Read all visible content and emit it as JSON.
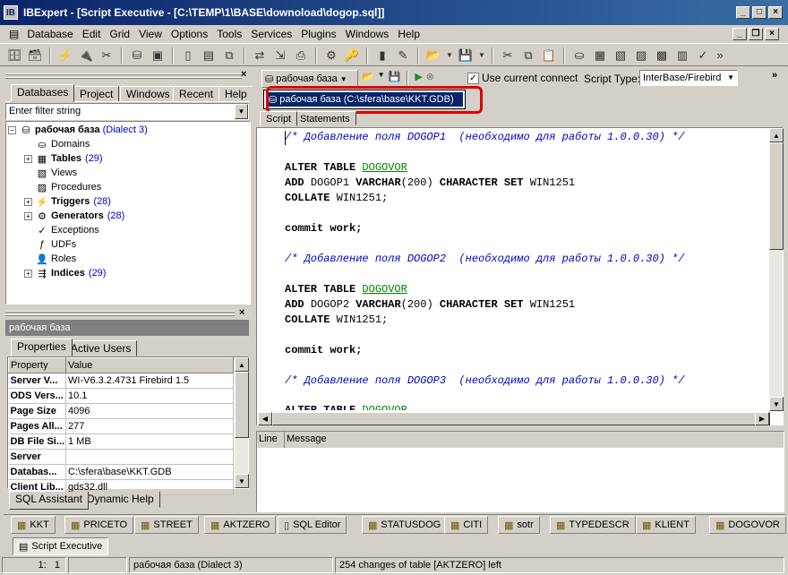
{
  "window": {
    "title": "IBExpert - [Script Executive - [C:\\TEMP\\1\\BASE\\downoload\\dogop.sql]]"
  },
  "menu": [
    "Database",
    "Edit",
    "Grid",
    "View",
    "Options",
    "Tools",
    "Services",
    "Plugins",
    "Windows",
    "Help"
  ],
  "db_explorer": {
    "tabs": [
      "Databases",
      "Project",
      "Windows",
      "Recent",
      "Help"
    ],
    "filter_placeholder": "Enter filter string",
    "db_name": "рабочая база",
    "db_dialect": "(Dialect 3)",
    "nodes": [
      {
        "label": "Domains",
        "count": "",
        "expandable": false,
        "bold": false
      },
      {
        "label": "Tables",
        "count": "(29)",
        "expandable": true,
        "bold": true
      },
      {
        "label": "Views",
        "count": "",
        "expandable": false,
        "bold": false
      },
      {
        "label": "Procedures",
        "count": "",
        "expandable": false,
        "bold": false
      },
      {
        "label": "Triggers",
        "count": "(28)",
        "expandable": true,
        "bold": true
      },
      {
        "label": "Generators",
        "count": "(28)",
        "expandable": true,
        "bold": true
      },
      {
        "label": "Exceptions",
        "count": "",
        "expandable": false,
        "bold": false
      },
      {
        "label": "UDFs",
        "count": "",
        "expandable": false,
        "bold": false
      },
      {
        "label": "Roles",
        "count": "",
        "expandable": false,
        "bold": false
      },
      {
        "label": "Indices",
        "count": "(29)",
        "expandable": true,
        "bold": true
      }
    ]
  },
  "props": {
    "title": "рабочая база",
    "tabs": [
      "Properties",
      "Active Users"
    ],
    "col_property": "Property",
    "col_value": "Value",
    "rows": [
      {
        "k": "Server V...",
        "v": "WI-V6.3.2.4731 Firebird 1.5"
      },
      {
        "k": "ODS Vers...",
        "v": "10.1"
      },
      {
        "k": "Page Size",
        "v": "4096"
      },
      {
        "k": "Pages All...",
        "v": "277"
      },
      {
        "k": "DB File Si...",
        "v": "1 MB"
      },
      {
        "k": "Server",
        "v": ""
      },
      {
        "k": "Databas...",
        "v": "C:\\sfera\\base\\KKT.GDB"
      },
      {
        "k": "Client Lib...",
        "v": "gds32.dll"
      }
    ],
    "bottom_tabs": [
      "SQL Assistant",
      "Dynamic Help"
    ]
  },
  "script": {
    "db_combo": "рабочая база",
    "dropdown_item": "рабочая база (C:\\sfera\\base\\KKT.GDB)",
    "use_current_connect": "Use current connect",
    "script_type_label": "Script Type:",
    "script_type_value": "InterBase/Firebird",
    "tabs": [
      "Script",
      "Statements"
    ],
    "comment1": "/* Добавление поля DOGOP1  (необходимо для работы 1.0.0.30) */",
    "comment2": "/* Добавление поля DOGOP2  (необходимо для работы 1.0.0.30) */",
    "comment3": "/* Добавление поля DOGOP3  (необходимо для работы 1.0.0.30) */",
    "alter": "ALTER TABLE",
    "table": "DOGOVOR",
    "add": "ADD",
    "field1": "DOGOP1",
    "field2": "DOGOP2",
    "varchar": "VARCHAR",
    "size": "(200)",
    "charset": "CHARACTER SET",
    "win": "WIN1251",
    "collate": "COLLATE",
    "win_semi": "WIN1251;",
    "commit": "commit work;",
    "msg_col_line": "Line",
    "msg_col_message": "Message"
  },
  "taskbar": [
    "KKT",
    "PRICETO",
    "STREET",
    "AKTZERO",
    "SQL Editor",
    "STATUSDOG",
    "CITI",
    "sotr",
    "TYPEDESCR",
    "KLIENT",
    "DOGOVOR"
  ],
  "active_window": "Script Executive",
  "statusbar": {
    "pos_line": "1",
    "pos_col": "1",
    "db": "рабочая база (Dialect 3)",
    "msg": "254 changes of table [AKTZERO] left"
  },
  "colors": {
    "highlight": "#0a246a",
    "callout": "#e00000",
    "comment": "#0000c0",
    "table_link": "#008000"
  }
}
